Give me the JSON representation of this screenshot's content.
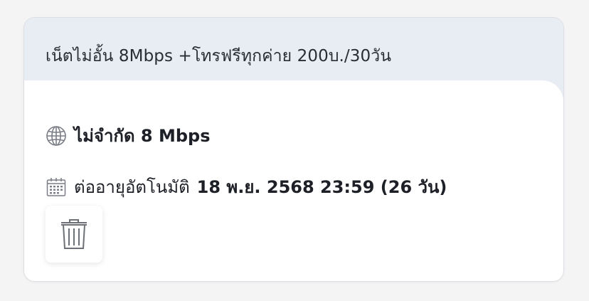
{
  "package": {
    "title": "เน็ตไม่อั้น 8Mbps +โทรฟรีทุกค่าย 200บ./30วัน",
    "speed": "ไม่จำกัด 8 Mbps",
    "renew_label": "ต่ออายุอัตโนมัติ",
    "renew_date": "18 พ.ย. 2568 23:59 (26 วัน)"
  },
  "icons": {
    "speed": "globe-icon",
    "renew": "calendar-icon",
    "delete": "trash-icon"
  },
  "colors": {
    "header_bg": "#e8ecf3",
    "text": "#1e2027",
    "icon": "#7a7d85"
  }
}
